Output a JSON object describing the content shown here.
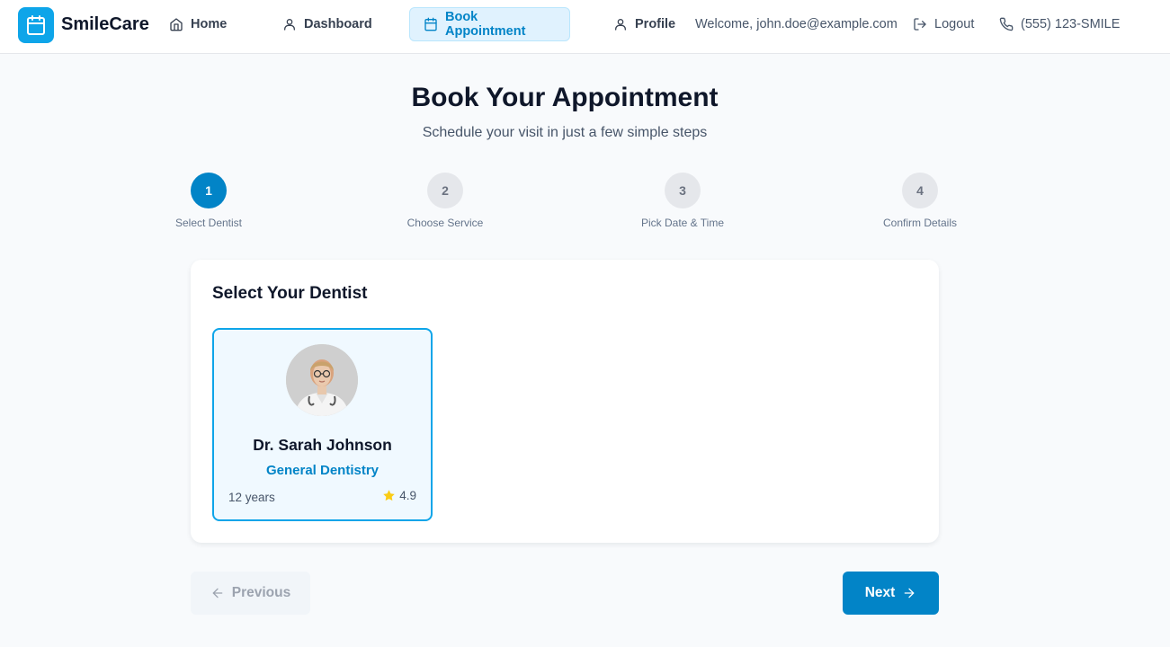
{
  "header": {
    "brand": "SmileCare",
    "nav": {
      "home": "Home",
      "dashboard": "Dashboard",
      "book": "Book Appointment",
      "profile": "Profile",
      "welcome": "Welcome, john.doe@example.com",
      "logout": "Logout",
      "phone": "(555) 123-SMILE"
    }
  },
  "page": {
    "title": "Book Your Appointment",
    "subtitle": "Schedule your visit in just a few simple steps"
  },
  "steps": [
    {
      "number": "1",
      "label": "Select Dentist",
      "active": true
    },
    {
      "number": "2",
      "label": "Choose Service",
      "active": false
    },
    {
      "number": "3",
      "label": "Pick Date & Time",
      "active": false
    },
    {
      "number": "4",
      "label": "Confirm Details",
      "active": false
    }
  ],
  "card": {
    "title": "Select Your Dentist",
    "dentists": [
      {
        "name": "Dr. Sarah Johnson",
        "specialty": "General Dentistry",
        "experience": "12 years",
        "rating": "4.9",
        "selected": true
      }
    ]
  },
  "actions": {
    "previous": "Previous",
    "next": "Next"
  },
  "colors": {
    "accent": "#0284c7",
    "brand": "#0ea5e9",
    "star": "#facc15"
  },
  "icons": [
    "calendar-icon",
    "home-icon",
    "user-icon",
    "logout-icon",
    "phone-icon",
    "star-icon",
    "arrow-left-icon",
    "arrow-right-icon"
  ]
}
